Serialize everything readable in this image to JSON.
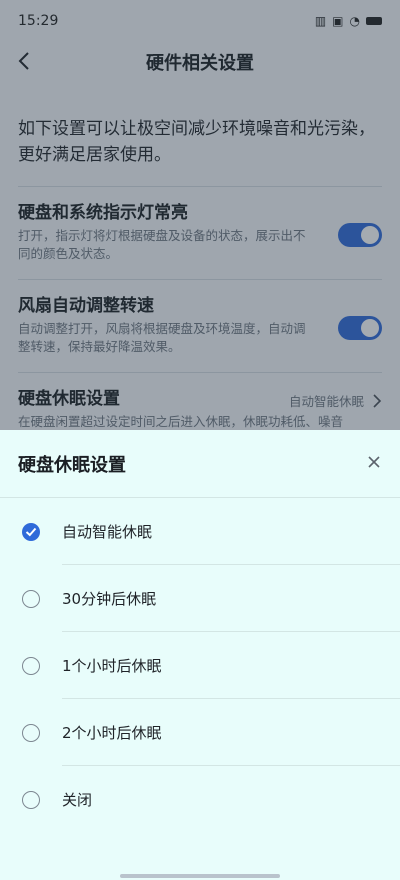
{
  "status": {
    "time": "15:29"
  },
  "nav": {
    "title": "硬件相关设置"
  },
  "intro": "如下设置可以让极空间减少环境噪音和光污染，更好满足居家使用。",
  "settings": [
    {
      "title": "硬盘和系统指示灯常亮",
      "desc": "打开，指示灯将灯根据硬盘及设备的状态，展示出不同的颜色及状态。",
      "enabled": true
    },
    {
      "title": "风扇自动调整转速",
      "desc": "自动调整打开，风扇将根据硬盘及环境温度，自动调整转速，保持最好降温效果。",
      "enabled": true
    },
    {
      "title": "硬盘休眠设置",
      "desc": "在硬盘闲置超过设定时间之后进入休眠，休眠功耗低、噪音",
      "value": "自动智能休眠"
    }
  ],
  "sheet": {
    "title": "硬盘休眠设置",
    "options": [
      {
        "label": "自动智能休眠",
        "selected": true
      },
      {
        "label": "30分钟后休眠",
        "selected": false
      },
      {
        "label": "1个小时后休眠",
        "selected": false
      },
      {
        "label": "2个小时后休眠",
        "selected": false
      },
      {
        "label": "关闭",
        "selected": false
      }
    ]
  },
  "colors": {
    "accent": "#2f6ad9",
    "sheet_bg": "#e8fdfb"
  }
}
